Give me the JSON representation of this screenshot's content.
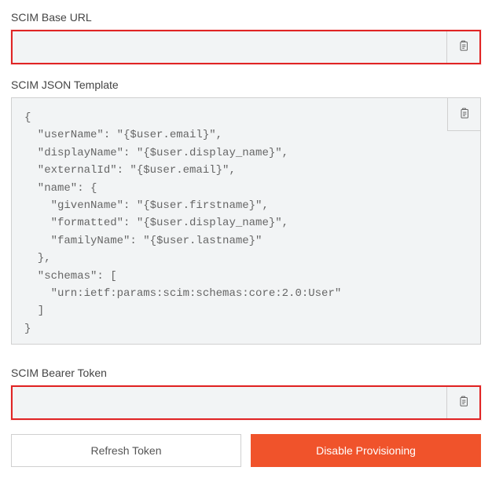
{
  "fields": {
    "scim_base_url": {
      "label": "SCIM Base URL",
      "value": ""
    },
    "scim_json_template": {
      "label": "SCIM JSON Template",
      "value": "{\n  \"userName\": \"{$user.email}\",\n  \"displayName\": \"{$user.display_name}\",\n  \"externalId\": \"{$user.email}\",\n  \"name\": {\n    \"givenName\": \"{$user.firstname}\",\n    \"formatted\": \"{$user.display_name}\",\n    \"familyName\": \"{$user.lastname}\"\n  },\n  \"schemas\": [\n    \"urn:ietf:params:scim:schemas:core:2.0:User\"\n  ]\n}"
    },
    "scim_bearer_token": {
      "label": "SCIM Bearer Token",
      "value": ""
    }
  },
  "buttons": {
    "refresh_token": "Refresh Token",
    "disable_provisioning": "Disable Provisioning"
  },
  "colors": {
    "danger": "#f0532b",
    "highlight_border": "#e02424"
  }
}
